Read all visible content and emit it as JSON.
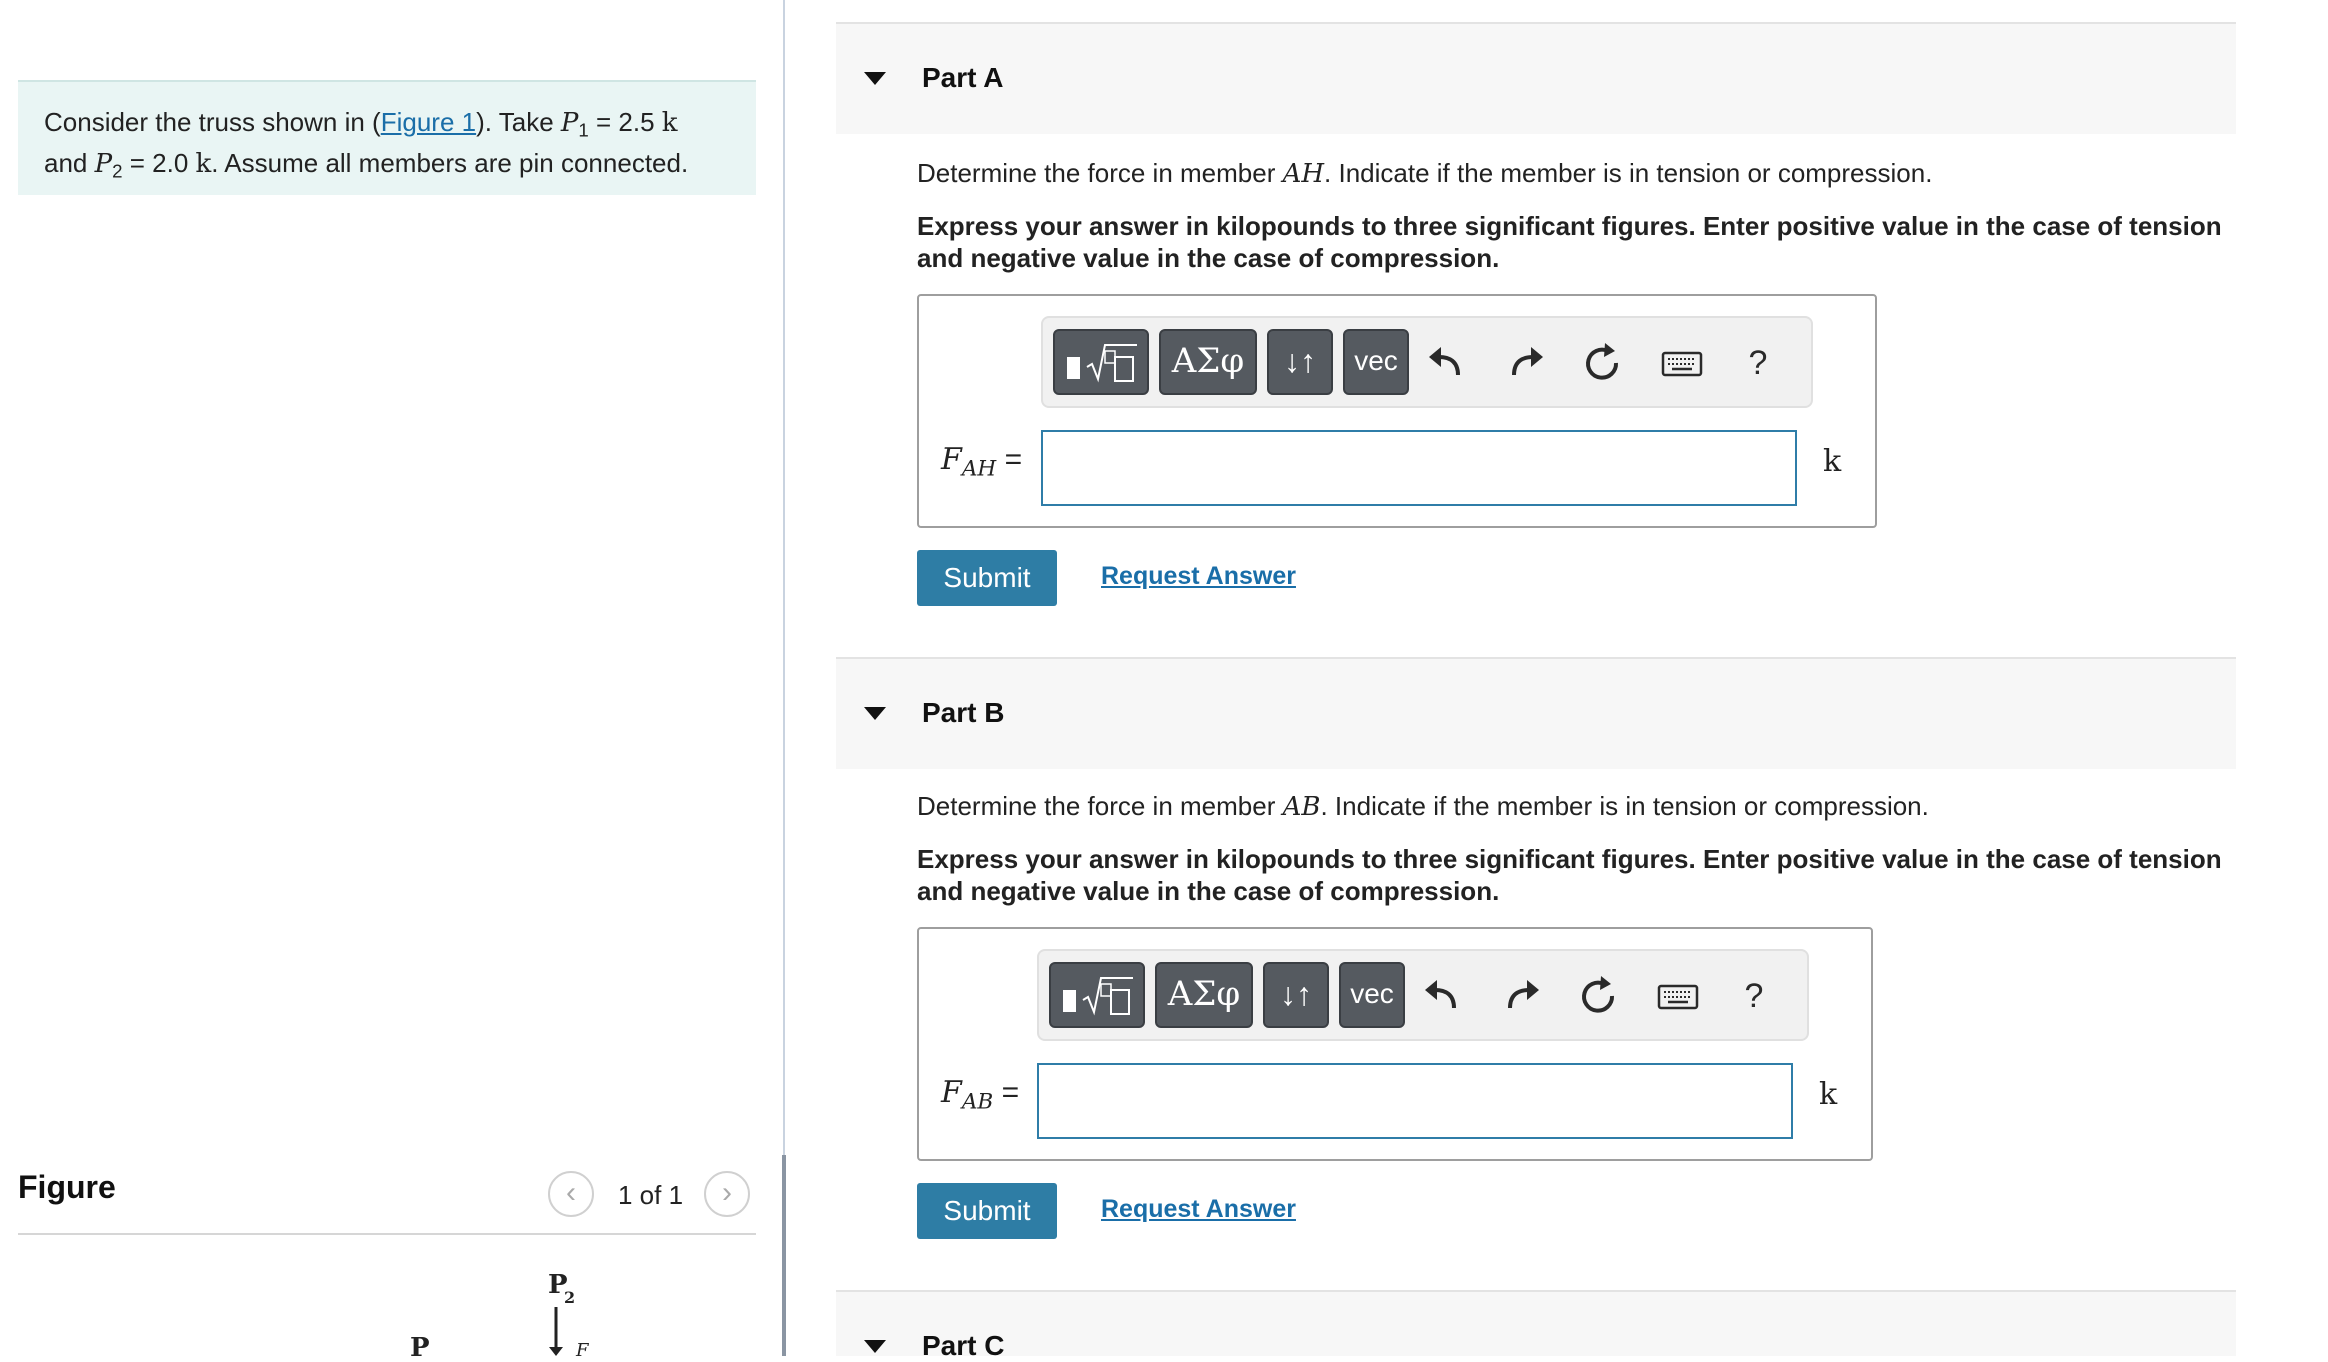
{
  "problem": {
    "text_before_link": "Consider the truss shown in (",
    "figure_link": "Figure 1",
    "text_after_link": "). Take ",
    "p1_symbol": "P",
    "p1_sub": "1",
    "p1_eq": " = 2.5 ",
    "unit_k": "k",
    "line2_start": "and ",
    "p2_symbol": "P",
    "p2_sub": "2",
    "p2_eq": " = 2.0 ",
    "line2_end": ". Assume all members are pin connected."
  },
  "figure": {
    "title": "Figure",
    "counter": "1 of 1",
    "prev_label": "‹",
    "next_label": "›",
    "label_p2": "P",
    "label_p2_sub": "2",
    "label_p1": "P",
    "label_f": "F"
  },
  "parts": [
    {
      "title": "Part A",
      "question_before": "Determine the force in member ",
      "member": "AH",
      "question_after": ". Indicate if the member is in tension or compression.",
      "instruction": "Express your answer in kilopounds to three significant figures. Enter positive value in the case of tension and negative value in the case of compression.",
      "field_symbol": "F",
      "field_sub": "AH",
      "field_eq": " =",
      "input_value": "",
      "unit": "k",
      "submit_label": "Submit",
      "request_label": "Request Answer"
    },
    {
      "title": "Part B",
      "question_before": "Determine the force in member ",
      "member": "AB",
      "question_after": ". Indicate if the member is in tension or compression.",
      "instruction": "Express your answer in kilopounds to three significant figures. Enter positive value in the case of tension and negative value in the case of compression.",
      "field_symbol": "F",
      "field_sub": "AB",
      "field_eq": " =",
      "input_value": "",
      "unit": "k",
      "submit_label": "Submit",
      "request_label": "Request Answer"
    },
    {
      "title": "Part C"
    }
  ],
  "toolbar": {
    "greek_label": "ΑΣφ",
    "arrows_label": "↓↑",
    "vec_label": "vec",
    "help_label": "?",
    "icons": [
      "templates-icon",
      "undo-icon",
      "redo-icon",
      "reset-icon",
      "keyboard-icon"
    ]
  },
  "colors": {
    "accent": "#2e7da5",
    "link": "#1a6ea8",
    "problem_bg": "#e9f5f4",
    "toolbar_button": "#555a60"
  }
}
